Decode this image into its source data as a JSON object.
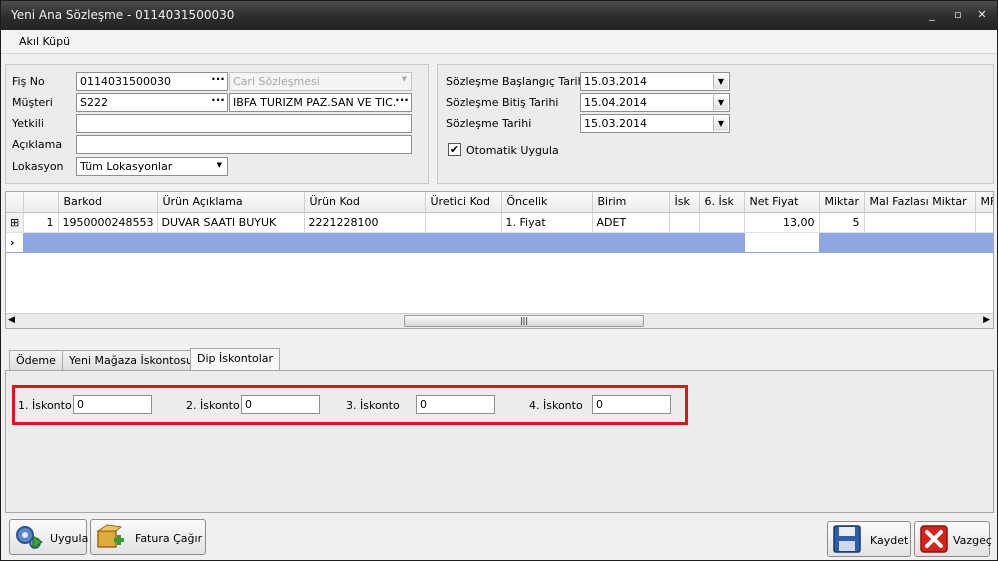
{
  "window": {
    "title": "Yeni Ana Sözleşme - 0114031500030",
    "controls": [
      "_",
      "▫",
      "✕"
    ]
  },
  "menu": {
    "items": [
      "Akıl Küpü"
    ]
  },
  "form_left": {
    "fis_no_label": "Fiş No",
    "fis_no_value": "0114031500030",
    "cari_placeholder": "Cari Sözleşmesi",
    "musteri_label": "Müşteri",
    "musteri_code": "S222",
    "musteri_name": "IBFA TURIZM PAZ.SAN VE TIC.LT",
    "yetkili_label": "Yetkili",
    "yetkili_value": "",
    "aciklama_label": "Açıklama",
    "aciklama_value": "",
    "lokasyon_label": "Lokasyon",
    "lokasyon_value": "Tüm Lokasyonlar",
    "ellipsis": "···"
  },
  "form_right": {
    "baslangic_label": "Sözleşme Başlangıç Tarihi",
    "baslangic_value": "15.03.2014",
    "bitis_label": "Sözleşme Bitiş Tarihi",
    "bitis_value": "15.04.2014",
    "tarih_label": "Sözleşme Tarihi",
    "tarih_value": "15.03.2014",
    "otomatik_label": "Otomatik Uygula",
    "otomatik_checked": true,
    "check_mark": "✔",
    "dropdown_arrow": "▼"
  },
  "grid": {
    "columns": [
      "",
      "Barkod",
      "Ürün Açıklama",
      "Ürün Kod",
      "Üretici Kod",
      "Öncelik",
      "Birim",
      "İsk",
      "6. İsk",
      "Net Fiyat",
      "Miktar",
      "Mal Fazlası Miktar",
      "MF"
    ],
    "rows": [
      {
        "row_no": "1",
        "expand": "⊞",
        "barkod": "1950000248553",
        "urun_aciklama": "DUVAR SAATI BUYUK",
        "urun_kod": "2221228100",
        "uretici_kod": "",
        "oncelik": "1. Fiyat",
        "birim": "ADET",
        "isk": "",
        "isk6": "",
        "net_fiyat": "13,00",
        "miktar": "5",
        "mal_fazlasi": "",
        "mf": ""
      }
    ],
    "new_row_indicator": "›",
    "scroll_left": "◀",
    "scroll_right": "▶",
    "scroll_thumb": "|||"
  },
  "tabs": [
    {
      "label": "Ödeme",
      "active": false
    },
    {
      "label": "Yeni Mağaza İskontosu",
      "active": false
    },
    {
      "label": "Dip İskontolar",
      "active": true
    }
  ],
  "discounts": [
    {
      "label": "1. İskonto",
      "value": "0"
    },
    {
      "label": "2. İskonto",
      "value": "0"
    },
    {
      "label": "3. İskonto",
      "value": "0"
    },
    {
      "label": "4. İskonto",
      "value": "0"
    }
  ],
  "buttons": {
    "uygula": "Uygula",
    "fatura": "Fatura Çağır",
    "kaydet": "Kaydet",
    "vazgec": "Vazgeç"
  },
  "colors": {
    "highlight_border": "#e0141b",
    "selected_row": "#8da8e0",
    "titlebar": "#2d2d2d"
  }
}
